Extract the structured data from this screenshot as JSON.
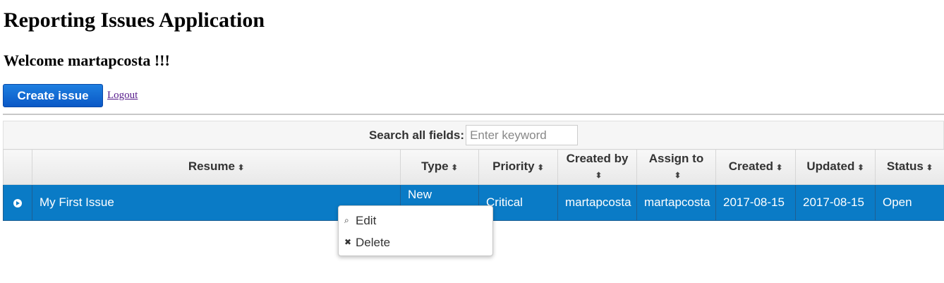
{
  "header": {
    "title": "Reporting Issues Application",
    "welcome": "Welcome martapcosta !!!"
  },
  "actions": {
    "create_label": "Create issue",
    "logout_label": "Logout"
  },
  "search": {
    "label": "Search all fields:",
    "placeholder": "Enter keyword"
  },
  "table": {
    "columns": [
      "Resume",
      "Type",
      "Priority",
      "Created by",
      "Assign to",
      "Created",
      "Updated",
      "Status"
    ],
    "sort_icon": "⬍",
    "rows": [
      {
        "resume": "My First Issue",
        "type": "New",
        "priority": "Critical",
        "created_by": "martapcosta",
        "assign_to": "martapcosta",
        "created": "2017-08-15",
        "updated": "2017-08-15",
        "status": "Open"
      }
    ]
  },
  "context_menu": {
    "items": [
      {
        "label": "Edit",
        "icon": "search-icon"
      },
      {
        "label": "Delete",
        "icon": "close-icon"
      }
    ]
  },
  "colors": {
    "selected_row": "#0a7bc6",
    "primary_button": "#0a58c6",
    "visited_link": "#551a8b"
  }
}
